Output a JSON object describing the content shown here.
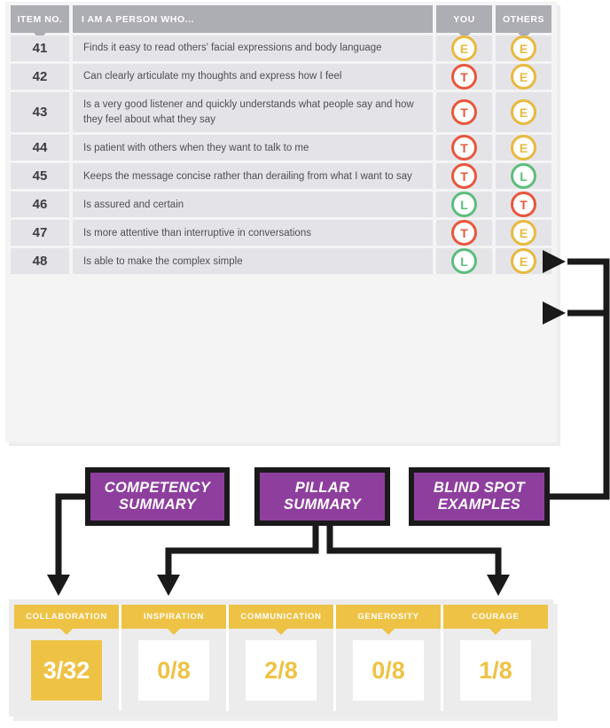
{
  "table": {
    "columns": {
      "item_no": "ITEM NO.",
      "statement": "I AM A PERSON WHO...",
      "you": "YOU",
      "others": "OTHERS"
    },
    "rows": [
      {
        "no": "41",
        "text": "Finds it easy to read others' facial expressions and body language",
        "you": "E",
        "others": "E"
      },
      {
        "no": "42",
        "text": "Can clearly articulate my thoughts and express how I feel",
        "you": "T",
        "others": "E"
      },
      {
        "no": "43",
        "text": "Is a very good listener and quickly understands what people say and how they feel about what they say",
        "you": "T",
        "others": "E"
      },
      {
        "no": "44",
        "text": "Is patient with others when they want to talk to me",
        "you": "T",
        "others": "E"
      },
      {
        "no": "45",
        "text": "Keeps the message concise rather than derailing from what I want to say",
        "you": "T",
        "others": "L"
      },
      {
        "no": "46",
        "text": "Is assured and certain",
        "you": "L",
        "others": "T"
      },
      {
        "no": "47",
        "text": "Is more attentive than interruptive in conversations",
        "you": "T",
        "others": "E"
      },
      {
        "no": "48",
        "text": "Is able to make the complex simple",
        "you": "L",
        "others": "E"
      }
    ]
  },
  "callouts": [
    {
      "id": "competency",
      "label": "COMPETENCY\nSUMMARY"
    },
    {
      "id": "pillar",
      "label": "PILLAR\nSUMMARY"
    },
    {
      "id": "blindspot",
      "label": "BLIND SPOT\nEXAMPLES"
    }
  ],
  "scorecard": {
    "pillars": [
      {
        "name": "COLLABORATION",
        "score": "3/32",
        "highlighted": true
      },
      {
        "name": "INSPIRATION",
        "score": "0/8",
        "highlighted": false
      },
      {
        "name": "COMMUNICATION",
        "score": "2/8",
        "highlighted": false
      },
      {
        "name": "GENEROSITY",
        "score": "0/8",
        "highlighted": false
      },
      {
        "name": "COURAGE",
        "score": "1/8",
        "highlighted": false
      }
    ]
  },
  "colors": {
    "header_gray": "#adadb4",
    "row_gray": "#e4e4e8",
    "purple": "#8e3f9e",
    "gold": "#eec244",
    "circle_e": "#e7b93e",
    "circle_t": "#e9563c",
    "circle_l": "#5dbd7e",
    "connector": "#1a1a1a"
  }
}
